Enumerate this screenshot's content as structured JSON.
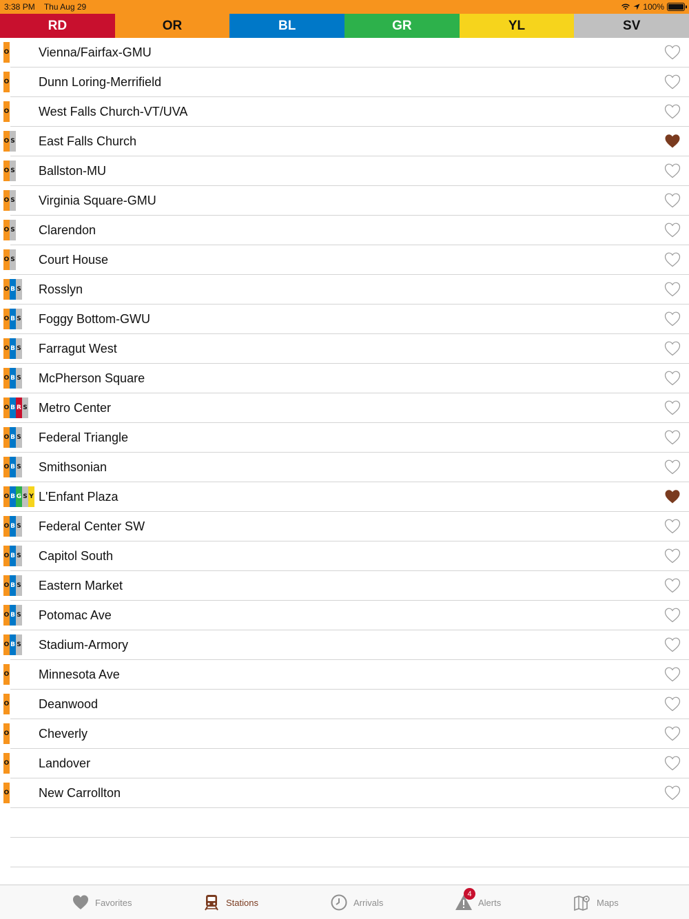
{
  "status_bar": {
    "time": "3:38 PM",
    "date": "Thu Aug 29",
    "battery": "100%",
    "icons": [
      "wifi-icon",
      "location-arrow-icon",
      "battery-icon"
    ]
  },
  "line_tabs": [
    {
      "code": "RD",
      "color": "#c8102e",
      "text_color": "#ffffff"
    },
    {
      "code": "OR",
      "color": "#f7941d",
      "text_color": "#111111"
    },
    {
      "code": "BL",
      "color": "#0078c8",
      "text_color": "#ffffff"
    },
    {
      "code": "GR",
      "color": "#2db14b",
      "text_color": "#ffffff"
    },
    {
      "code": "YL",
      "color": "#f6d41c",
      "text_color": "#111111"
    },
    {
      "code": "SV",
      "color": "#c0c0c0",
      "text_color": "#111111"
    }
  ],
  "line_colors": {
    "O": "#f7941d",
    "B": "#0078c8",
    "R": "#c8102e",
    "G": "#2db14b",
    "Y": "#f6d41c",
    "S": "#c0c0c0"
  },
  "favorite_color": "#7a3b1f",
  "stations": [
    {
      "name": "Vienna/Fairfax-GMU",
      "lines": [
        "O"
      ],
      "favorite": false
    },
    {
      "name": "Dunn Loring-Merrifield",
      "lines": [
        "O"
      ],
      "favorite": false
    },
    {
      "name": "West Falls Church-VT/UVA",
      "lines": [
        "O"
      ],
      "favorite": false
    },
    {
      "name": "East Falls Church",
      "lines": [
        "O",
        "S"
      ],
      "favorite": true
    },
    {
      "name": "Ballston-MU",
      "lines": [
        "O",
        "S"
      ],
      "favorite": false
    },
    {
      "name": "Virginia Square-GMU",
      "lines": [
        "O",
        "S"
      ],
      "favorite": false
    },
    {
      "name": "Clarendon",
      "lines": [
        "O",
        "S"
      ],
      "favorite": false
    },
    {
      "name": "Court House",
      "lines": [
        "O",
        "S"
      ],
      "favorite": false
    },
    {
      "name": "Rosslyn",
      "lines": [
        "O",
        "B",
        "S"
      ],
      "favorite": false
    },
    {
      "name": "Foggy Bottom-GWU",
      "lines": [
        "O",
        "B",
        "S"
      ],
      "favorite": false
    },
    {
      "name": "Farragut West",
      "lines": [
        "O",
        "B",
        "S"
      ],
      "favorite": false
    },
    {
      "name": "McPherson Square",
      "lines": [
        "O",
        "B",
        "S"
      ],
      "favorite": false
    },
    {
      "name": "Metro Center",
      "lines": [
        "O",
        "B",
        "R",
        "S"
      ],
      "favorite": false
    },
    {
      "name": "Federal Triangle",
      "lines": [
        "O",
        "B",
        "S"
      ],
      "favorite": false
    },
    {
      "name": "Smithsonian",
      "lines": [
        "O",
        "B",
        "S"
      ],
      "favorite": false
    },
    {
      "name": "L'Enfant Plaza",
      "lines": [
        "O",
        "B",
        "G",
        "S",
        "Y"
      ],
      "favorite": true
    },
    {
      "name": "Federal Center SW",
      "lines": [
        "O",
        "B",
        "S"
      ],
      "favorite": false
    },
    {
      "name": "Capitol South",
      "lines": [
        "O",
        "B",
        "S"
      ],
      "favorite": false
    },
    {
      "name": "Eastern Market",
      "lines": [
        "O",
        "B",
        "S"
      ],
      "favorite": false
    },
    {
      "name": "Potomac Ave",
      "lines": [
        "O",
        "B",
        "S"
      ],
      "favorite": false
    },
    {
      "name": "Stadium-Armory",
      "lines": [
        "O",
        "B",
        "S"
      ],
      "favorite": false
    },
    {
      "name": "Minnesota Ave",
      "lines": [
        "O"
      ],
      "favorite": false
    },
    {
      "name": "Deanwood",
      "lines": [
        "O"
      ],
      "favorite": false
    },
    {
      "name": "Cheverly",
      "lines": [
        "O"
      ],
      "favorite": false
    },
    {
      "name": "Landover",
      "lines": [
        "O"
      ],
      "favorite": false
    },
    {
      "name": "New Carrollton",
      "lines": [
        "O"
      ],
      "favorite": false
    }
  ],
  "tab_bar": {
    "favorites": {
      "label": "Favorites",
      "icon": "heart-icon"
    },
    "stations": {
      "label": "Stations",
      "icon": "train-icon",
      "active": true
    },
    "arrivals": {
      "label": "Arrivals",
      "icon": "clock-icon"
    },
    "alerts": {
      "label": "Alerts",
      "icon": "warning-icon",
      "badge": "4"
    },
    "maps": {
      "label": "Maps",
      "icon": "map-icon"
    }
  }
}
